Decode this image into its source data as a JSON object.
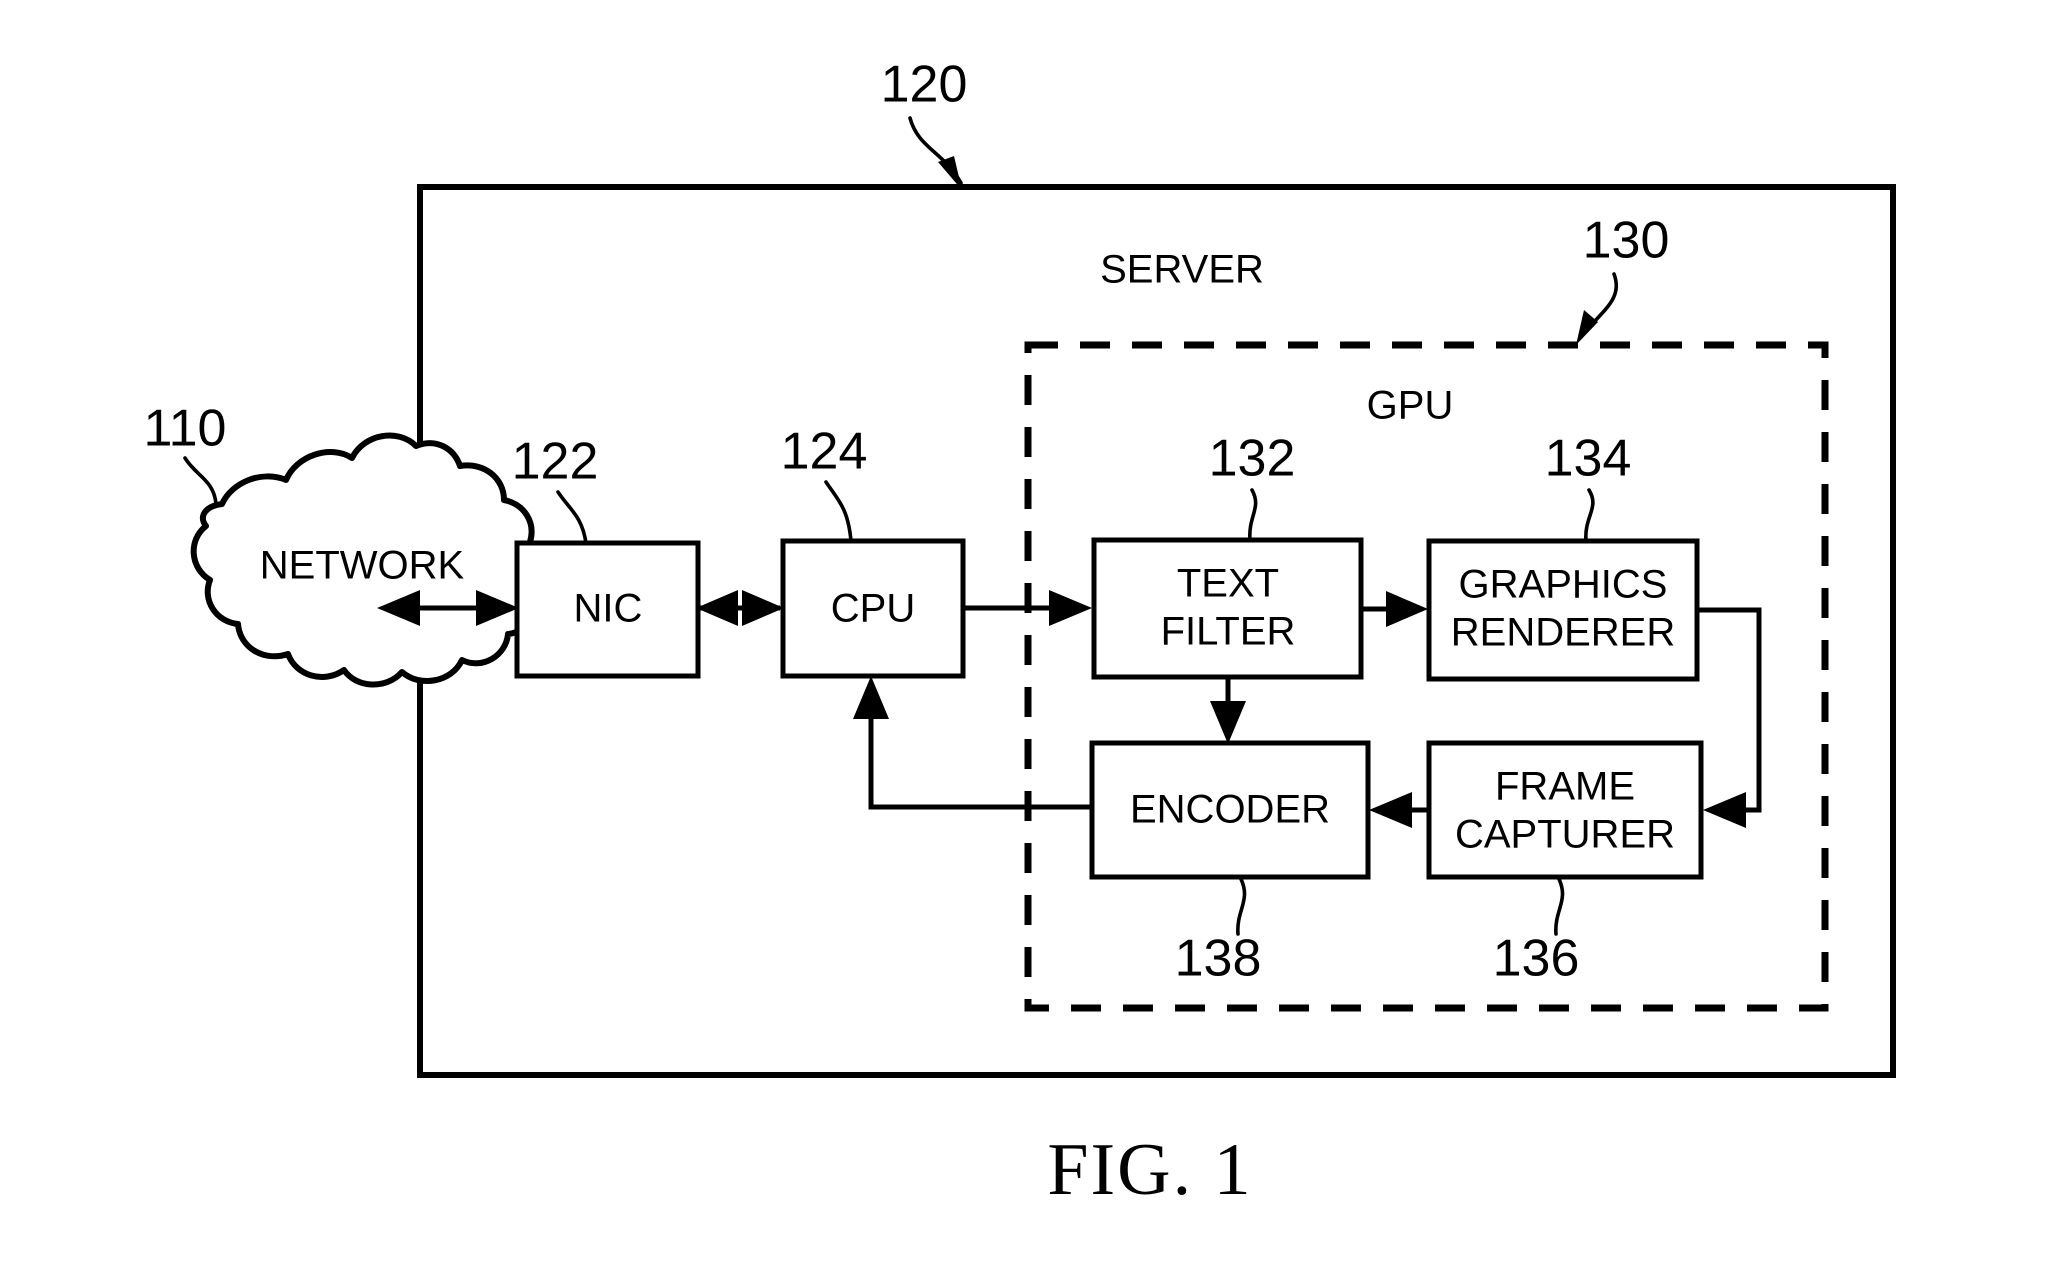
{
  "figure": {
    "caption": "FIG. 1",
    "regions": {
      "server_label": "SERVER",
      "gpu_label": "GPU"
    },
    "nodes": {
      "network": {
        "label": "NETWORK",
        "ref": "110",
        "shape": "cloud"
      },
      "nic": {
        "label": "NIC",
        "ref": "122",
        "shape": "rect"
      },
      "cpu": {
        "label": "CPU",
        "ref": "124",
        "shape": "rect"
      },
      "text_filter": {
        "label_line1": "TEXT",
        "label_line2": "FILTER",
        "ref": "132",
        "shape": "rect"
      },
      "graphics_renderer": {
        "label_line1": "GRAPHICS",
        "label_line2": "RENDERER",
        "ref": "134",
        "shape": "rect"
      },
      "frame_capturer": {
        "label_line1": "FRAME",
        "label_line2": "CAPTURER",
        "ref": "136",
        "shape": "rect"
      },
      "encoder": {
        "label": "ENCODER",
        "ref": "138",
        "shape": "rect"
      },
      "server": {
        "ref": "120",
        "shape": "solid-enclosure"
      },
      "gpu": {
        "ref": "130",
        "shape": "dashed-enclosure"
      }
    },
    "colors": {
      "stroke": "#000000",
      "fill": "#ffffff",
      "text": "#000000"
    }
  }
}
